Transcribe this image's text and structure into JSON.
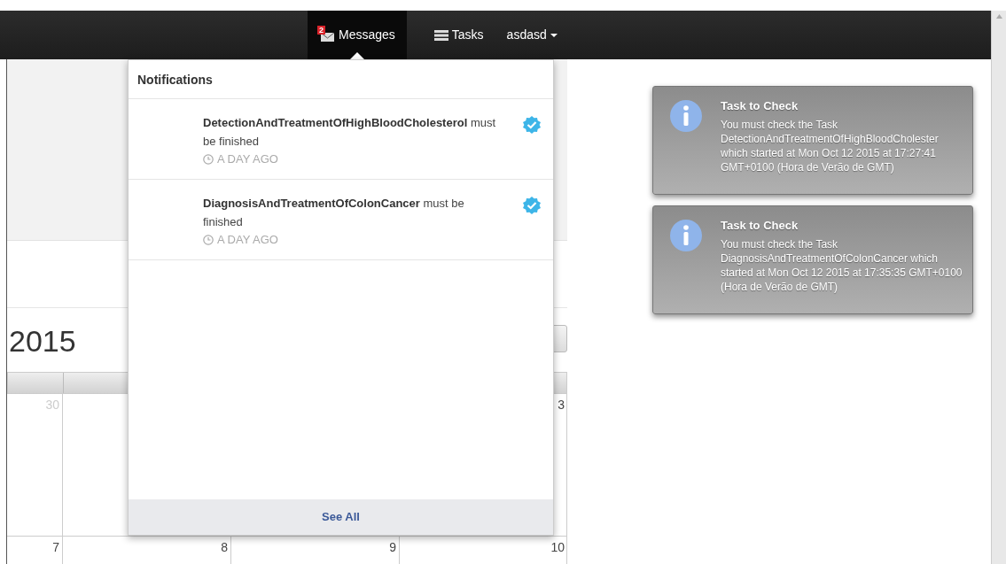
{
  "navbar": {
    "items": [
      {
        "kind": "messages",
        "label": "Messages",
        "badge": "2",
        "selected": true
      },
      {
        "kind": "tasks",
        "label": "Tasks",
        "selected": false
      },
      {
        "kind": "user",
        "label": "asdasd",
        "selected": false
      }
    ]
  },
  "notifications": {
    "title": "Notifications",
    "items": [
      {
        "task": "DetectionAndTreatmentOfHighBloodCholesterol",
        "text": "must be finished",
        "time": "A DAY AGO",
        "verified": true
      },
      {
        "task": "DiagnosisAndTreatmentOfColonCancer",
        "text": "must be finished",
        "time": "A DAY AGO",
        "verified": true
      }
    ],
    "footer": "See All"
  },
  "toasts": [
    {
      "title": "Task to Check",
      "message": "You must check the Task DetectionAndTreatmentOfHighBloodCholester which started at Mon Oct 12 2015 at 17:27:41 GMT+0100 (Hora de Verão de GMT)"
    },
    {
      "title": "Task to Check",
      "message": "You must check the Task DiagnosisAndTreatmentOfColonCancer which started at Mon Oct 12 2015 at 17:35:35 GMT+0100 (Hora de Verão de GMT)"
    }
  ],
  "calendar": {
    "title": "2015",
    "weeks": [
      [
        {
          "day": "30",
          "other_month": true
        },
        {
          "day": "3",
          "other_month": false
        }
      ],
      [
        {
          "day": "7",
          "other_month": false
        },
        {
          "day": "8",
          "other_month": false
        },
        {
          "day": "9",
          "other_month": false
        },
        {
          "day": "10",
          "other_month": false
        }
      ]
    ]
  }
}
